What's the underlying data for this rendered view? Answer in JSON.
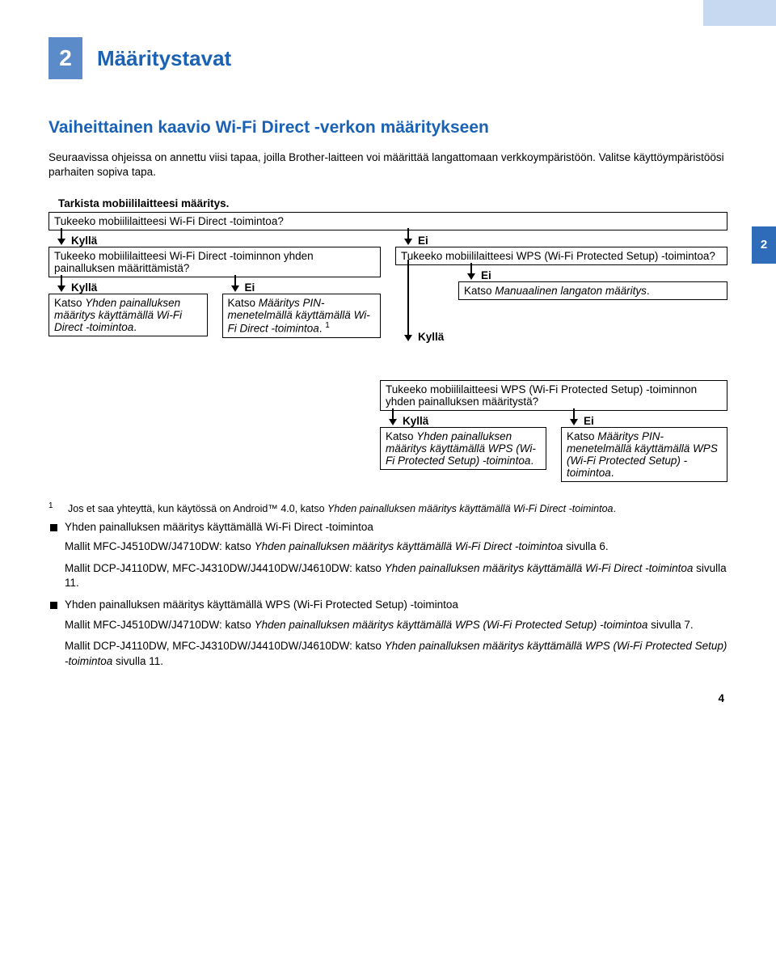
{
  "chapter": {
    "number": "2",
    "title": "Määritystavat",
    "side_tab": "2"
  },
  "section_title": "Vaiheittainen kaavio Wi-Fi Direct -verkon määritykseen",
  "intro": "Seuraavissa ohjeissa on annettu viisi tapaa, joilla Brother-laitteen voi määrittää langattomaan verkkoympäristöön. Valitse käyttöympäristöösi parhaiten sopiva tapa.",
  "flow": {
    "check_label": "Tarkista mobiililaitteesi määritys.",
    "q1": "Tukeeko mobiililaitteesi Wi-Fi Direct -toimintoa?",
    "yes": "Kyllä",
    "no": "Ei",
    "q2": "Tukeeko mobiililaitteesi Wi-Fi Direct -toiminnon yhden painalluksen määrittämistä?",
    "q3": "Tukeeko mobiililaitteesi WPS (Wi-Fi Protected Setup) -toimintoa?",
    "a1_pre": "Katso ",
    "a1_it": "Yhden painalluksen määritys käyttämällä Wi-Fi Direct -toimintoa",
    "a1_post": ".",
    "a2_pre": "Katso ",
    "a2_it": "Määritys PIN-menetelmällä käyttämällä Wi-Fi Direct -toimintoa",
    "a2_post": ". ",
    "a2_fn": "1",
    "a3_pre": "Katso ",
    "a3_it": "Manuaalinen langaton määritys",
    "a3_post": ".",
    "q4": "Tukeeko mobiililaitteesi WPS (Wi-Fi Protected Setup) -toiminnon yhden painalluksen määritystä?",
    "a4_pre": "Katso ",
    "a4_it": "Yhden painalluksen määritys käyttämällä WPS (Wi-Fi Protected Setup) -toimintoa",
    "a4_post": ".",
    "a5_pre": "Katso ",
    "a5_it": "Määritys PIN-menetelmällä käyttämällä WPS (Wi-Fi Protected Setup) -toimintoa",
    "a5_post": "."
  },
  "footnote": {
    "num": "1",
    "pre": "Jos et saa yhteyttä, kun käytössä on Android™ 4.0, katso ",
    "it": "Yhden painalluksen määritys käyttämällä Wi-Fi Direct -toimintoa",
    "post": "."
  },
  "bullets": [
    {
      "head": "Yhden painalluksen määritys käyttämällä Wi-Fi Direct -toimintoa",
      "subs": [
        {
          "pre": "Mallit MFC-J4510DW/J4710DW: katso ",
          "it": "Yhden painalluksen määritys käyttämällä Wi-Fi Direct -toimintoa",
          "post": " sivulla 6."
        },
        {
          "pre": "Mallit DCP-J4110DW, MFC-J4310DW/J4410DW/J4610DW: katso ",
          "it": "Yhden painalluksen määritys käyttämällä Wi-Fi Direct -toimintoa",
          "post": " sivulla 11."
        }
      ]
    },
    {
      "head": "Yhden painalluksen määritys käyttämällä WPS (Wi-Fi Protected Setup) -toimintoa",
      "subs": [
        {
          "pre": "Mallit MFC-J4510DW/J4710DW: katso ",
          "it": "Yhden painalluksen määritys käyttämällä WPS (Wi-Fi Protected Setup) -toimintoa",
          "post": " sivulla 7."
        },
        {
          "pre": "Mallit DCP-J4110DW, MFC-J4310DW/J4410DW/J4610DW: katso ",
          "it": "Yhden painalluksen määritys käyttämällä WPS (Wi-Fi Protected Setup) -toimintoa",
          "post": " sivulla 11."
        }
      ]
    }
  ],
  "page_number": "4"
}
